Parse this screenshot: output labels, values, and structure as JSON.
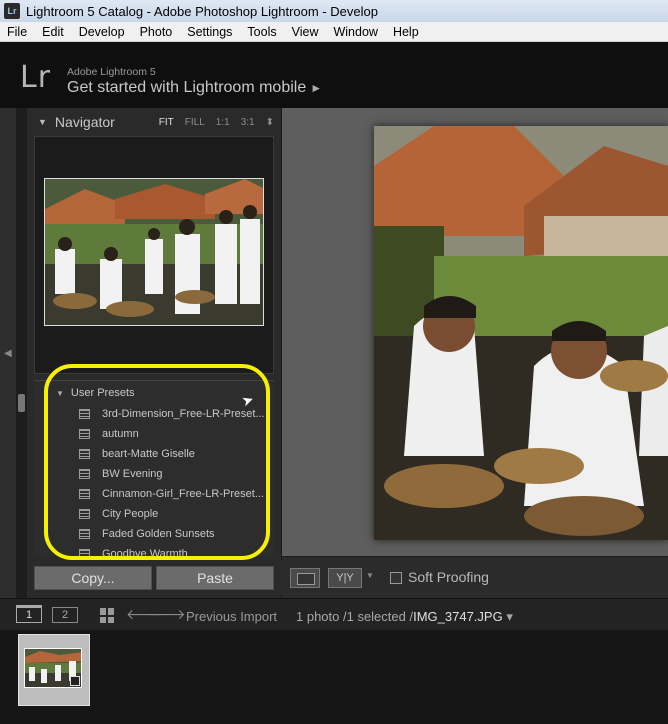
{
  "window": {
    "title": "Lightroom 5 Catalog - Adobe Photoshop Lightroom - Develop"
  },
  "menu": [
    "File",
    "Edit",
    "Develop",
    "Photo",
    "Settings",
    "Tools",
    "View",
    "Window",
    "Help"
  ],
  "identity": {
    "logo": "Lr",
    "product": "Adobe Lightroom 5",
    "mobile_text": "Get started with Lightroom mobile",
    "mobile_arrow": "►"
  },
  "navigator": {
    "title": "Navigator",
    "options": [
      "FIT",
      "FILL",
      "1:1",
      "3:1"
    ],
    "active_option": "FIT",
    "options_arrow": "⬍"
  },
  "presets": {
    "header": "User Presets",
    "items": [
      "3rd-Dimension_Free-LR-Preset...",
      "autumn",
      "beart-Matte Giselle",
      "BW Evening",
      "Cinnamon-Girl_Free-LR-Preset...",
      "City People",
      "Faded Golden Sunsets",
      "Goodbye Warmth"
    ]
  },
  "buttons": {
    "copy": "Copy...",
    "paste": "Paste"
  },
  "toolbar": {
    "yy_label": "Y|Y",
    "soft_proofing": "Soft Proofing"
  },
  "filmstrip_bar": {
    "view1": "1",
    "view2": "2",
    "source": "Previous Import",
    "count": "1 photo /1 selected /",
    "filename": "IMG_3747.JPG",
    "dropdown": "▾"
  },
  "colors": {
    "highlight": "#f7f000",
    "panel": "#2a2a2a",
    "view_bg": "#5e5e5e"
  }
}
